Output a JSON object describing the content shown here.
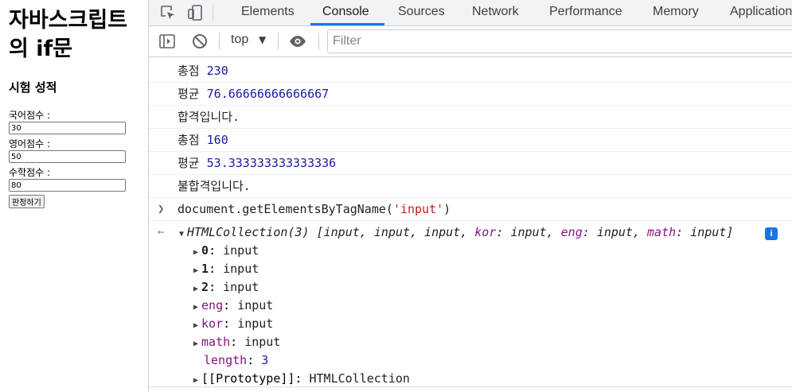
{
  "page": {
    "title": "자바스크립트의 if문",
    "subtitle": "시험 성적",
    "fields": [
      {
        "label": "국어점수 :",
        "value": "30"
      },
      {
        "label": "영어점수 :",
        "value": "50"
      },
      {
        "label": "수학점수 :",
        "value": "80"
      }
    ],
    "button_label": "판정하기"
  },
  "devtools": {
    "tabs": [
      "Elements",
      "Console",
      "Sources",
      "Network",
      "Performance",
      "Memory",
      "Application"
    ],
    "active_tab": "Console",
    "context": "top",
    "filter_placeholder": "Filter",
    "logs": [
      {
        "label": "총점",
        "value": "230"
      },
      {
        "label": "평균",
        "value": "76.66666666666667"
      },
      {
        "label": "합격입니다.",
        "value": ""
      },
      {
        "label": "총점",
        "value": "160"
      },
      {
        "label": "평균",
        "value": "53.333333333333336"
      },
      {
        "label": "불합격입니다.",
        "value": ""
      }
    ],
    "command": {
      "prefix": "document.getElementsByTagName(",
      "arg": "'input'",
      "suffix": ")"
    },
    "result": {
      "type_name": "HTMLCollection(3)",
      "preview_open": " [input, input, input, ",
      "kor_key": "kor",
      "eng_key": "eng",
      "math_key": "math",
      "preview_value": "input",
      "preview_close": "]",
      "info_glyph": "i"
    },
    "props": [
      {
        "key": "0",
        "value": "input"
      },
      {
        "key": "1",
        "value": "input"
      },
      {
        "key": "2",
        "value": "input"
      },
      {
        "key": "eng",
        "value": "input"
      },
      {
        "key": "kor",
        "value": "input"
      },
      {
        "key": "math",
        "value": "input"
      }
    ],
    "length_key": "length",
    "length_value": "3",
    "prototype_key": "[[Prototype]]",
    "prototype_value": "HTMLCollection"
  },
  "colors": {
    "accent": "#1a73e8",
    "number": "#1a1aa6",
    "string": "#c41a16",
    "key": "#881280"
  },
  "icons": [
    "inspect-element-icon",
    "device-toolbar-icon",
    "sidebar-toggle-icon",
    "clear-console-icon",
    "eye-icon",
    "info-icon"
  ]
}
